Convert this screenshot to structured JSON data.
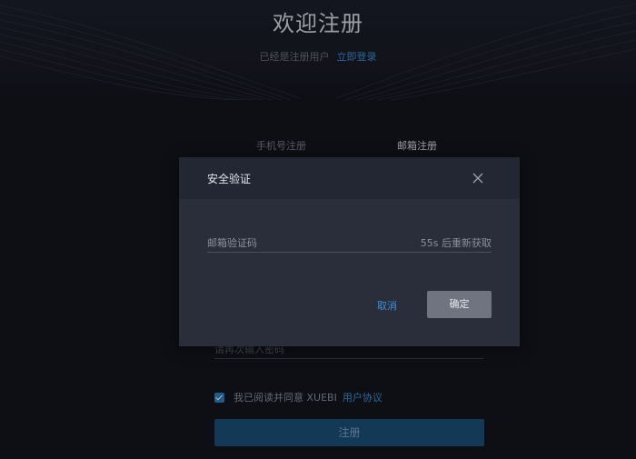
{
  "header": {
    "title": "欢迎注册",
    "subtitle_text": "已经是注册用户",
    "login_link": "立即登录"
  },
  "tabs": {
    "phone": "手机号注册",
    "email": "邮箱注册"
  },
  "form": {
    "obscured_field_text": "请再次输入密码",
    "agree_text": "我已阅读并同意 XUEBI",
    "agreement_link": "用户协议",
    "register_button": "注册"
  },
  "modal": {
    "title": "安全验证",
    "code_placeholder": "邮箱验证码",
    "resend_countdown": "55s 后重新获取",
    "cancel_label": "取消",
    "confirm_label": "确定"
  },
  "icons": {
    "close": "close-icon",
    "checkbox": "checkmark-icon"
  },
  "colors": {
    "background": "#14151c",
    "accent_link": "#3d8fd6",
    "register_button": "#1d4f79",
    "modal_bg": "#2a2e3b",
    "modal_header": "#232733",
    "confirm_button": "#6f7480"
  }
}
